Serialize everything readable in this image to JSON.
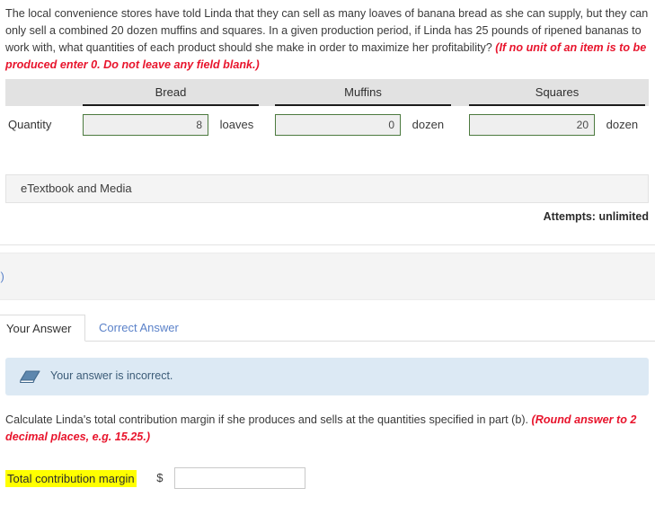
{
  "question": {
    "body": "The local convenience stores have told Linda that they can sell as many loaves of banana bread as she can supply, but they can only sell a combined 20 dozen muffins and squares. In a given production period, if Linda has 25 pounds of ripened bananas to work with, what quantities of each product should she make in order to maximize her profitability? ",
    "hint": "(If no unit of an item is to be produced enter 0. Do not leave any field blank.)"
  },
  "quantity_table": {
    "row_label": "Quantity",
    "columns": [
      {
        "header": "Bread",
        "value": "8",
        "unit": "loaves"
      },
      {
        "header": "Muffins",
        "value": "0",
        "unit": "dozen"
      },
      {
        "header": "Squares",
        "value": "20",
        "unit": "dozen"
      }
    ]
  },
  "etextbook": {
    "label": "eTextbook and Media"
  },
  "attempts": {
    "text": "Attempts: unlimited"
  },
  "part": {
    "label": "c)"
  },
  "tabs": {
    "your_answer": "Your Answer",
    "correct_answer": "Correct Answer"
  },
  "feedback": {
    "icon": "eraser-icon",
    "message": "Your answer is incorrect."
  },
  "sub_question": {
    "body": "Calculate Linda's total contribution margin if she produces and sells at the quantities specified in part (b). ",
    "hint": "(Round answer to 2 decimal places, e.g. 15.25.)"
  },
  "answer_row": {
    "label": "Total contribution margin",
    "currency": "$",
    "value": "",
    "placeholder": ""
  },
  "colors": {
    "hint_red": "#e8142c",
    "link_blue": "#5b82c9",
    "input_green_border": "#4c7a3f",
    "highlight_yellow": "#ffff00",
    "feedback_blue_bg": "#dce9f4",
    "header_gray": "#e2e2e2"
  }
}
